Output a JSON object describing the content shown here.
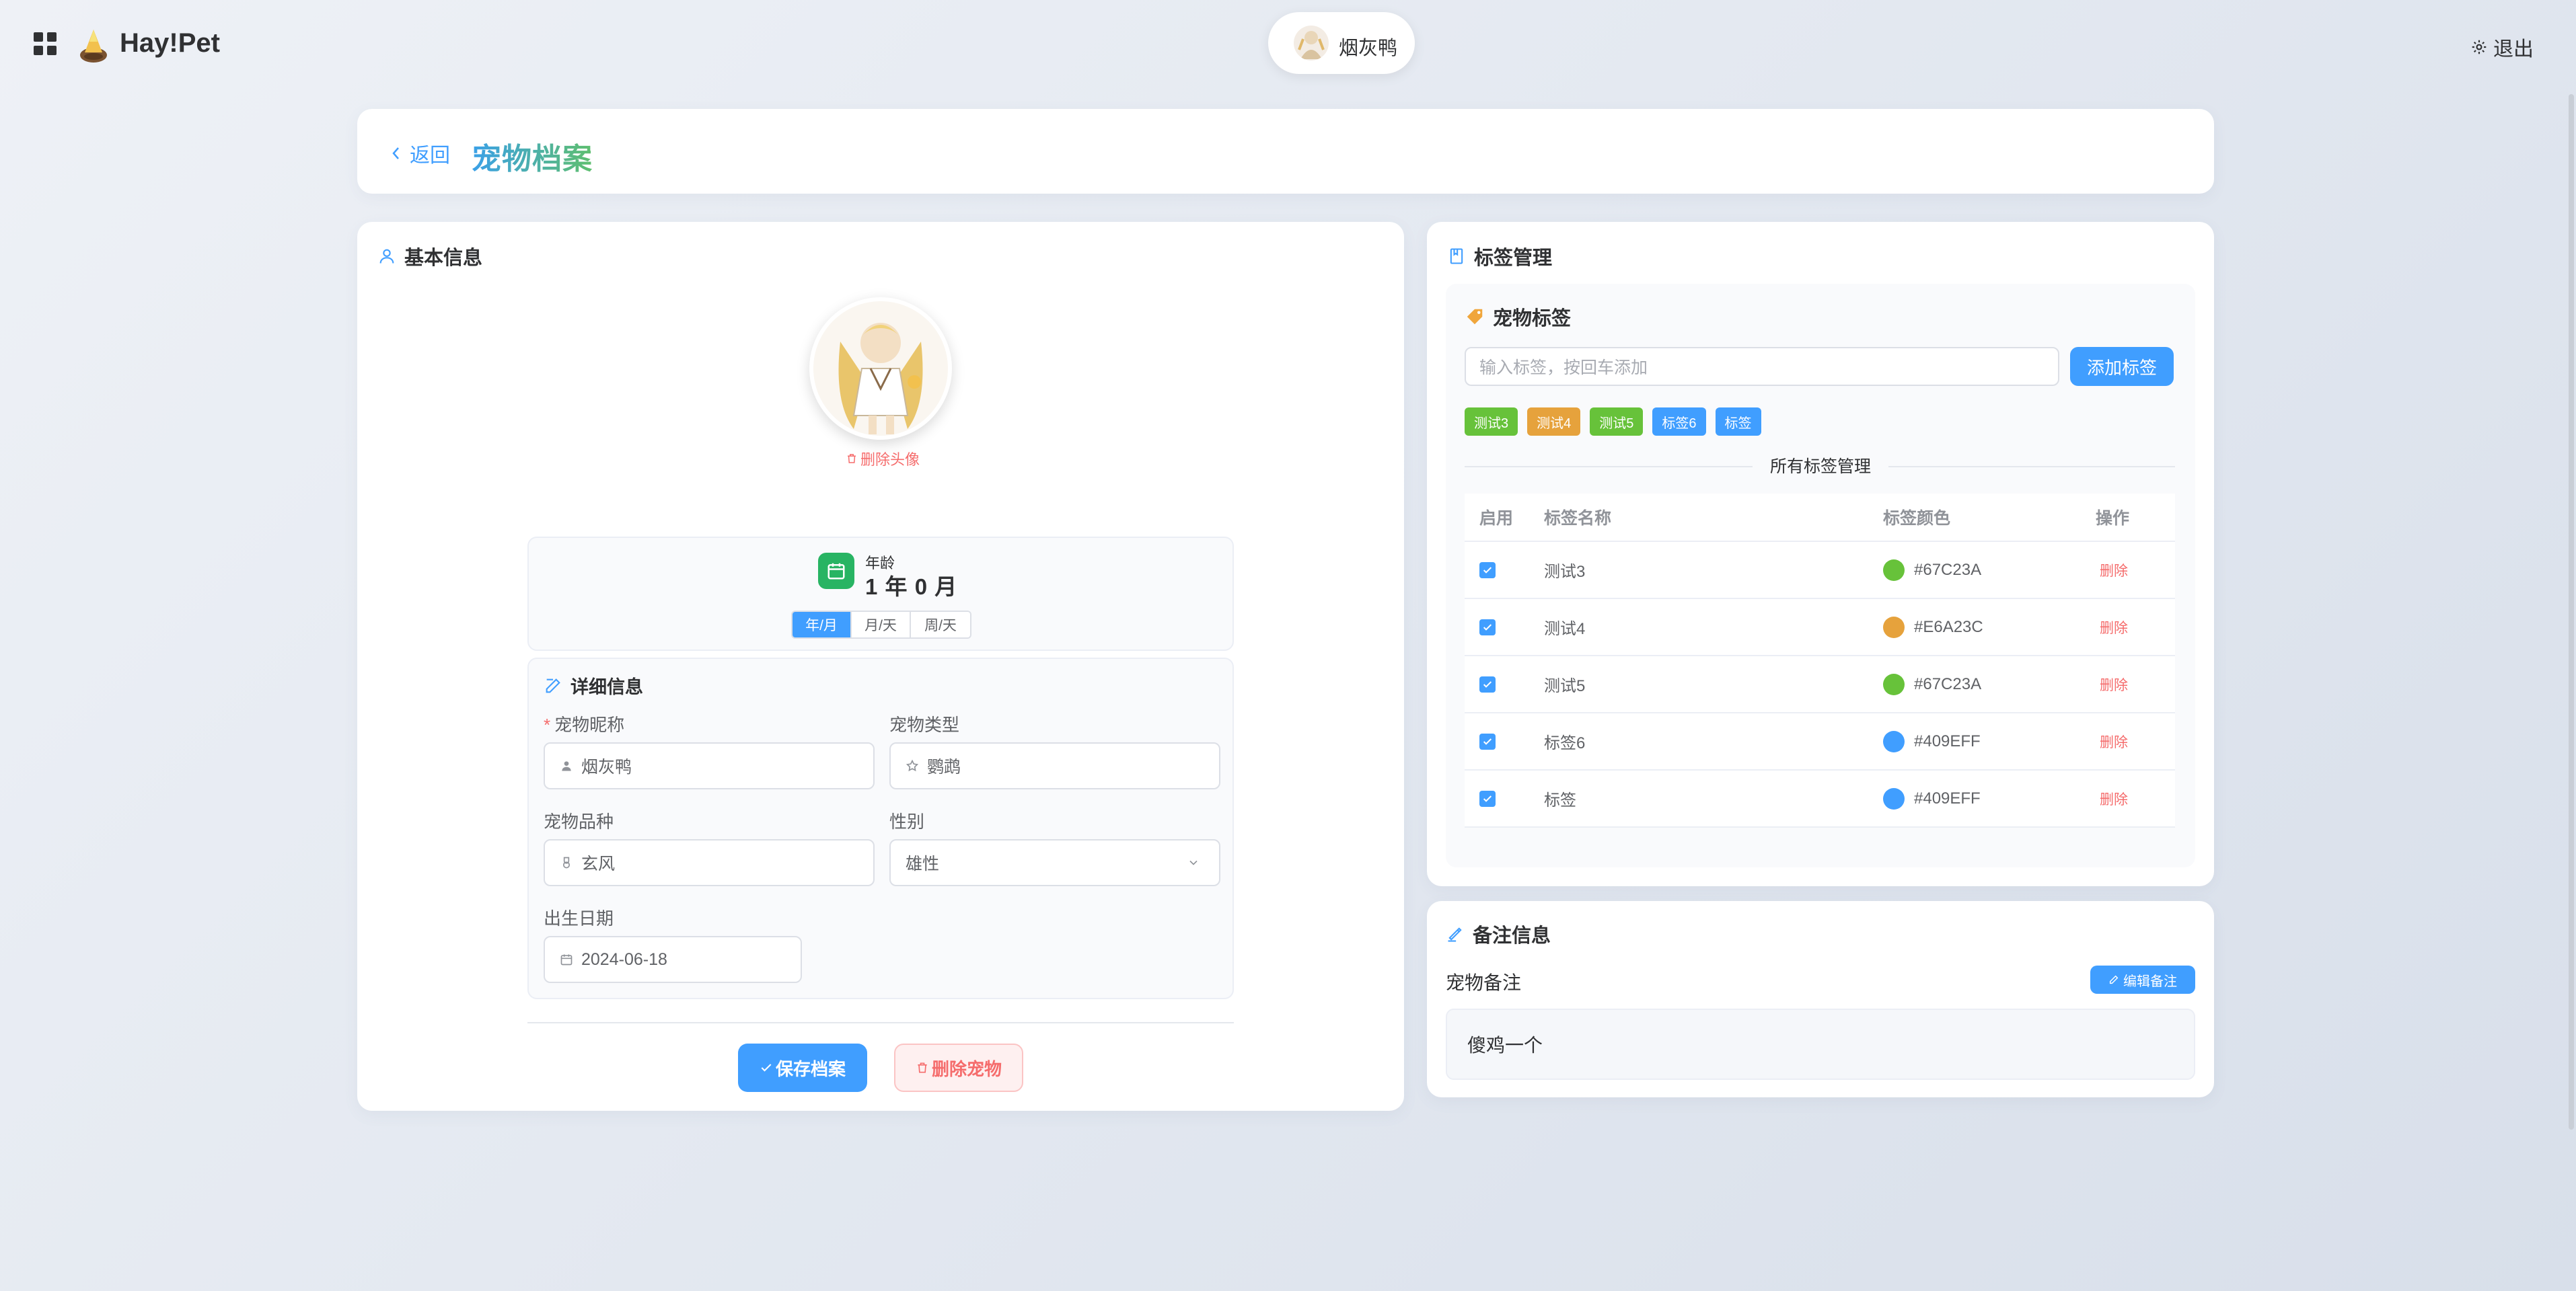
{
  "app": {
    "brand": "Hay!Pet",
    "user_name": "烟灰鸭",
    "logout_label": "退出"
  },
  "header": {
    "back_label": "返回",
    "page_title": "宠物档案"
  },
  "basic_info": {
    "title": "基本信息",
    "remove_avatar_label": "删除头像",
    "age": {
      "label": "年龄",
      "value": "1 年 0 月",
      "modes": [
        "年/月",
        "月/天",
        "周/天"
      ],
      "active_mode": "年/月"
    },
    "details": {
      "title": "详细信息",
      "nickname_label": "宠物昵称",
      "nickname_value": "烟灰鸭",
      "type_label": "宠物类型",
      "type_value": "鹦鹉",
      "breed_label": "宠物品种",
      "breed_value": "玄风",
      "gender_label": "性别",
      "gender_value": "雄性",
      "birth_label": "出生日期",
      "birth_value": "2024-06-18"
    },
    "save_label": "保存档案",
    "delete_label": "删除宠物"
  },
  "tags": {
    "card_title": "标签管理",
    "section_title": "宠物标签",
    "input_placeholder": "输入标签，按回车添加",
    "add_label": "添加标签",
    "chips": [
      {
        "label": "测试3",
        "color": "#67C23A"
      },
      {
        "label": "测试4",
        "color": "#E6A23C"
      },
      {
        "label": "测试5",
        "color": "#67C23A"
      },
      {
        "label": "标签6",
        "color": "#409EFF"
      },
      {
        "label": "标签",
        "color": "#409EFF"
      }
    ],
    "manage_title": "所有标签管理",
    "columns": [
      "启用",
      "标签名称",
      "标签颜色",
      "操作"
    ],
    "rows": [
      {
        "name": "测试3",
        "color": "#67C23A",
        "enabled": true,
        "action": "删除"
      },
      {
        "name": "测试4",
        "color": "#E6A23C",
        "enabled": true,
        "action": "删除"
      },
      {
        "name": "测试5",
        "color": "#67C23A",
        "enabled": true,
        "action": "删除"
      },
      {
        "name": "标签6",
        "color": "#409EFF",
        "enabled": true,
        "action": "删除"
      },
      {
        "name": "标签",
        "color": "#409EFF",
        "enabled": true,
        "action": "删除"
      }
    ]
  },
  "notes": {
    "card_title": "备注信息",
    "label": "宠物备注",
    "edit_label": "编辑备注",
    "content": "傻鸡一个"
  }
}
